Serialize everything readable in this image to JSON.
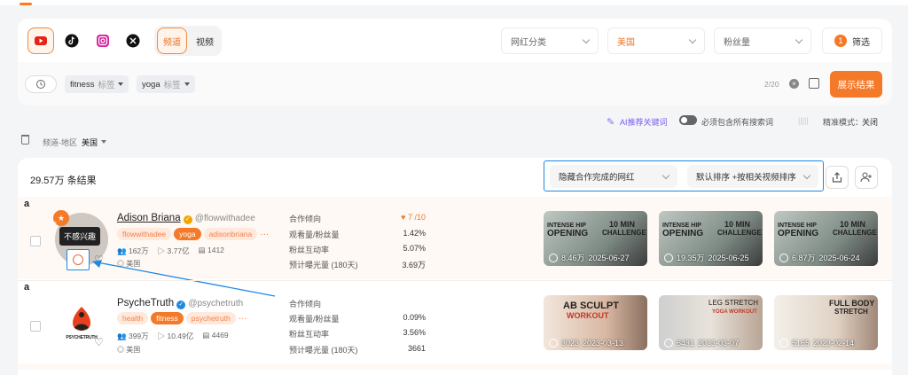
{
  "platforms": [
    {
      "name": "youtube-icon"
    },
    {
      "name": "tiktok-icon"
    },
    {
      "name": "instagram-icon"
    },
    {
      "name": "x-icon"
    }
  ],
  "modes": {
    "channel": "频道",
    "video": "视频"
  },
  "filters": {
    "category": "网红分类",
    "country": "美国",
    "followers": "粉丝量",
    "filter_count": "1",
    "filter_label": "筛选"
  },
  "search": {
    "tags": [
      {
        "text": "fitness",
        "sub": "标签"
      },
      {
        "text": "yoga",
        "sub": "标签"
      }
    ],
    "count": "2/20",
    "show_label": "展示结果"
  },
  "options": {
    "ai_keywords": "AI推荐关键词",
    "must_include": "必须包含所有搜索词",
    "precise_mode": "精准模式：",
    "precise_value": "关闭"
  },
  "region": {
    "label": "频道-地区",
    "value": "美国"
  },
  "results": {
    "count": "29.57万 条结果",
    "hide_completed": "隐藏合作完成的网红",
    "sort": "默认排序 +按相关视频排序"
  },
  "tooltip": "不感兴趣",
  "rows": [
    {
      "name": "Adison Briana",
      "handle": "@flowwithadee",
      "tags": [
        "flowwithadee",
        "yoga",
        "adisonbriana"
      ],
      "more": "···",
      "followers": "162万",
      "views": "3.77亿",
      "videos": "1412",
      "location": "美国",
      "rank": "3",
      "metrics": {
        "coop_label": "合作倾向",
        "coop_value": "7 /10",
        "ratio_label": "观看量/粉丝量",
        "ratio_value": "1.42%",
        "engage_label": "粉丝互动率",
        "engage_value": "5.07%",
        "exposure_label": "预计曝光量 (180天)",
        "exposure_value": "3.69万"
      },
      "videos_list": [
        {
          "t1": "INTENSE HIP",
          "t2": "OPENING",
          "t3": "10 MIN",
          "t4": "CHALLENGE",
          "views": "8.46万",
          "date": "2025-06-27"
        },
        {
          "t1": "INTENSE HIP",
          "t2": "OPENING",
          "t3": "10 MIN",
          "t4": "CHALLENGE",
          "views": "19.35万",
          "date": "2025-06-25"
        },
        {
          "t1": "INTENSE HIP",
          "t2": "OPENING",
          "t3": "10 MIN",
          "t4": "CHALLENGE",
          "views": "6.87万",
          "date": "2025-06-24"
        }
      ]
    },
    {
      "name": "PsycheTruth",
      "handle": "@psychetruth",
      "tags": [
        "health",
        "fitness",
        "psychetruth"
      ],
      "more": "···",
      "followers": "399万",
      "views": "10.49亿",
      "videos": "4469",
      "location": "美国",
      "logo_text": "PSYCHETRUTH",
      "metrics": {
        "coop_label": "合作倾向",
        "ratio_label": "观看量/粉丝量",
        "ratio_value": "0.09%",
        "engage_label": "粉丝互动率",
        "engage_value": "3.56%",
        "exposure_label": "预计曝光量 (180天)",
        "exposure_value": "3661"
      },
      "videos_list": [
        {
          "t1": "AB SCULPT",
          "t2": "WORKOUT",
          "views": "3023",
          "date": "2023-03-13"
        },
        {
          "t1": "LEG STRETCH",
          "t2": "YOGA WORKOUT",
          "views": "6431",
          "date": "2023-03-07"
        },
        {
          "t1": "FULL BODY",
          "t2": "STRETCH",
          "views": "5165",
          "date": "2023-02-14"
        }
      ]
    }
  ],
  "colors": {
    "accent": "#f47a2a",
    "blue": "#1e88e5"
  }
}
